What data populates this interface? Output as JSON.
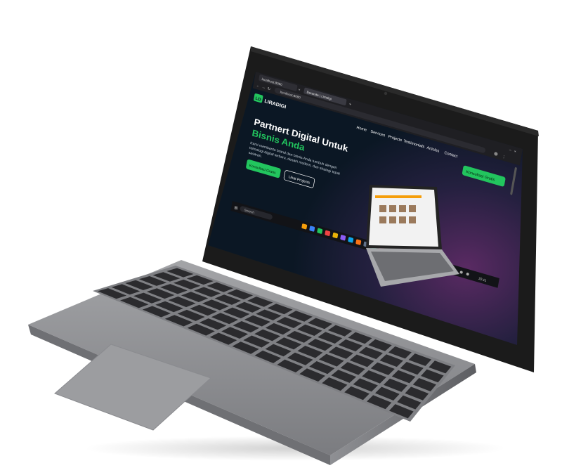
{
  "browser": {
    "tab1_label": "localhost:8080",
    "tab2_label": "Beranda | Liradigi",
    "url": "localhost:8080"
  },
  "site": {
    "logo_badge": "LD",
    "logo_text": "LIRADIGI",
    "nav": [
      "Home",
      "Services",
      "Projects",
      "Testimonials",
      "Articles",
      "Contact"
    ],
    "cta_top": "Konsultasi Gratis",
    "hero_line1": "Partnert Digital Untuk",
    "hero_line2": "Bisnis Anda",
    "hero_desc_1": "Kami membantu brand dan bisnis Anda tumbuh dengan",
    "hero_desc_2": "teknologi digital terbaru, desain modern, dan strategi tepat",
    "hero_desc_3": "sasaran.",
    "btn_primary": "Konsultasi Gratis",
    "btn_secondary": "Lihat Projects"
  },
  "taskbar": {
    "search": "Search",
    "time": "22:11"
  },
  "colors": {
    "accent": "#22c55e",
    "page_bg": "#0b1724",
    "bezel": "#161616",
    "body": "#8c8d90"
  }
}
